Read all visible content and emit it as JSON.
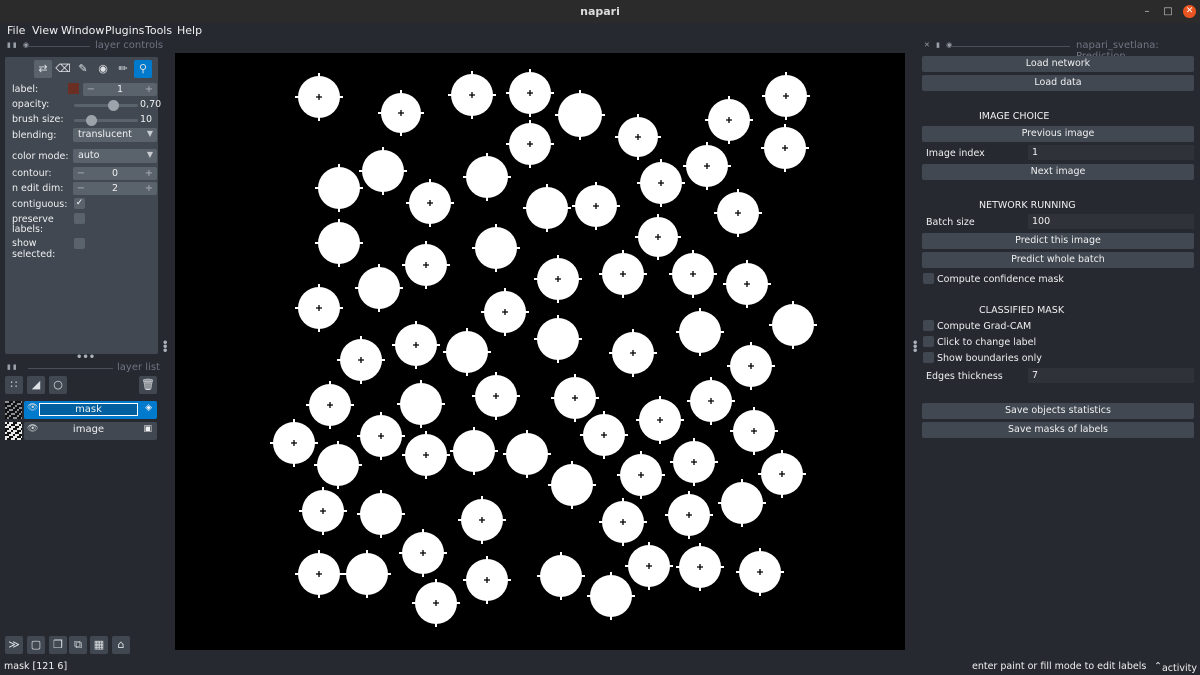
{
  "window": {
    "title": "napari"
  },
  "menu": [
    "File",
    "View",
    "Window",
    "Plugins",
    "Tools",
    "Help"
  ],
  "layer_controls": {
    "title": "layer controls",
    "label_label": "label:",
    "label_value": "1",
    "label_color": "#6b2e22",
    "opacity_label": "opacity:",
    "opacity_value": "0,70",
    "opacity_level": 0.7,
    "brush_label": "brush size:",
    "brush_value": "10",
    "blending_label": "blending:",
    "blending_value": "translucent",
    "color_mode_label": "color mode:",
    "color_mode_value": "auto",
    "contour_label": "contour:",
    "contour_value": "0",
    "n_edit_label": "n edit dim:",
    "n_edit_value": "2",
    "contiguous_label": "contiguous:",
    "contiguous_checked": true,
    "preserve_label_1": "preserve",
    "preserve_label_2": "labels:",
    "show_selected_label_1": "show",
    "show_selected_label_2": "selected:",
    "tools": [
      "shuffle-icon",
      "eraser-icon",
      "paint-brush-icon",
      "fill-bucket-icon",
      "color-picker-icon",
      "zoom-icon"
    ],
    "active_tool": "zoom-icon"
  },
  "layer_list": {
    "title": "layer list",
    "layers": [
      {
        "name": "mask",
        "type_icon": "labels-icon",
        "selected": true
      },
      {
        "name": "image",
        "type_icon": "image-icon",
        "selected": false
      }
    ]
  },
  "plugin": {
    "title": "napari_svetlana: Prediction",
    "load_network": "Load network",
    "load_data": "Load data",
    "image_choice_header": "IMAGE CHOICE",
    "previous_image": "Previous image",
    "image_index_label": "Image index",
    "image_index_value": "1",
    "next_image": "Next image",
    "network_running_header": "NETWORK RUNNING",
    "batch_size_label": "Batch size",
    "batch_size_value": "100",
    "predict_this": "Predict this image",
    "predict_batch": "Predict whole batch",
    "confidence_mask": "Compute confidence mask",
    "classified_mask_header": "CLASSIFIED MASK",
    "grad_cam": "Compute Grad-CAM",
    "click_change": "Click to change label",
    "show_boundaries": "Show boundaries only",
    "edges_thickness_label": "Edges thickness",
    "edges_thickness_value": "7",
    "save_stats": "Save objects statistics",
    "save_masks": "Save masks of labels"
  },
  "status": {
    "left": "mask [121  6]",
    "hint": "enter paint or fill mode to edit labels",
    "activity": "activity"
  }
}
